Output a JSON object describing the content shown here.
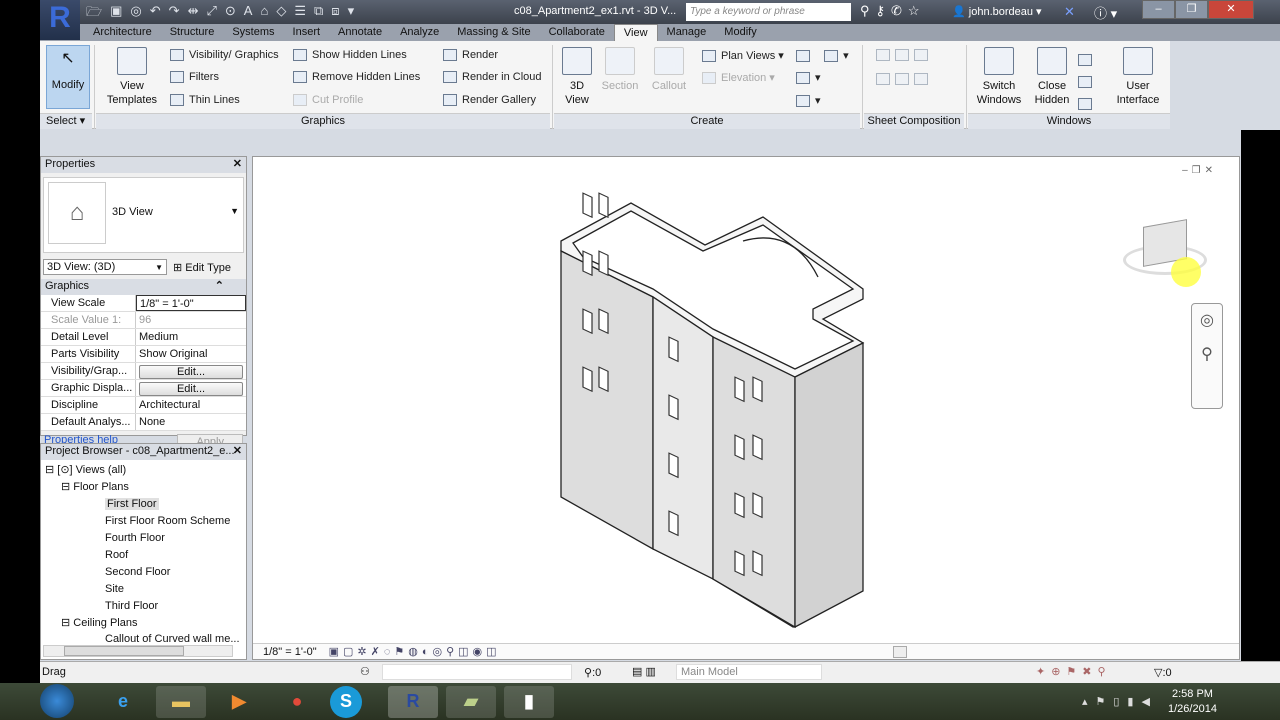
{
  "app": {
    "document_title": "c08_Apartment2_ex1.rvt - 3D V...",
    "search_placeholder": "Type a keyword or phrase",
    "user": "john.bordeau"
  },
  "tabs": [
    "Architecture",
    "Structure",
    "Systems",
    "Insert",
    "Annotate",
    "Analyze",
    "Massing & Site",
    "Collaborate",
    "View",
    "Manage",
    "Modify"
  ],
  "active_tab": "View",
  "ribbon": {
    "modify": "Modify",
    "select": "Select ▾",
    "view_templates": [
      "View",
      "Templates"
    ],
    "visibility_graphics": "Visibility/ Graphics",
    "filters": "Filters",
    "thin_lines": "Thin Lines",
    "show_hidden": "Show Hidden Lines",
    "remove_hidden": "Remove Hidden Lines",
    "cut_profile": "Cut Profile",
    "render": "Render",
    "render_cloud": "Render in Cloud",
    "render_gallery": "Render Gallery",
    "graphics_panel": "Graphics",
    "view3d": [
      "3D",
      "View"
    ],
    "section": "Section",
    "callout": "Callout",
    "plan_views": "Plan Views ▾",
    "elevation": "Elevation ▾",
    "create_panel": "Create",
    "sheet_panel": "Sheet Composition",
    "switch_windows": [
      "Switch",
      "Windows"
    ],
    "close_hidden": [
      "Close",
      "Hidden"
    ],
    "user_interface": [
      "User",
      "Interface"
    ],
    "windows_panel": "Windows"
  },
  "properties": {
    "title": "Properties",
    "type_name": "3D View",
    "selector": "3D View: (3D)",
    "edit_type": "Edit Type",
    "section": "Graphics",
    "rows": [
      {
        "k": "View Scale",
        "v": "1/8\" = 1'-0\""
      },
      {
        "k": "Scale Value    1:",
        "v": "96"
      },
      {
        "k": "Detail Level",
        "v": "Medium"
      },
      {
        "k": "Parts Visibility",
        "v": "Show Original"
      },
      {
        "k": "Visibility/Grap...",
        "v": "Edit..."
      },
      {
        "k": "Graphic Displa...",
        "v": "Edit..."
      },
      {
        "k": "Discipline",
        "v": "Architectural"
      },
      {
        "k": "Default Analys...",
        "v": "None"
      }
    ],
    "help": "Properties help",
    "apply": "Apply"
  },
  "project_browser": {
    "title": "Project Browser - c08_Apartment2_e...",
    "views_all": "Views (all)",
    "floor_plans": "Floor Plans",
    "floor_items": [
      "First Floor",
      "First Floor Room Scheme",
      "Fourth Floor",
      "Roof",
      "Second Floor",
      "Site",
      "Third Floor"
    ],
    "selected": "First Floor",
    "ceiling_plans": "Ceiling Plans",
    "ceiling_items": [
      "Callout of Curved wall me..."
    ]
  },
  "view_control": {
    "scale": "1/8\" = 1'-0\""
  },
  "status": {
    "text": "Drag",
    "filter_count": ":0",
    "selection_count": ":0",
    "model": "Main Model"
  },
  "clock": {
    "time": "2:58 PM",
    "date": "1/26/2014"
  }
}
